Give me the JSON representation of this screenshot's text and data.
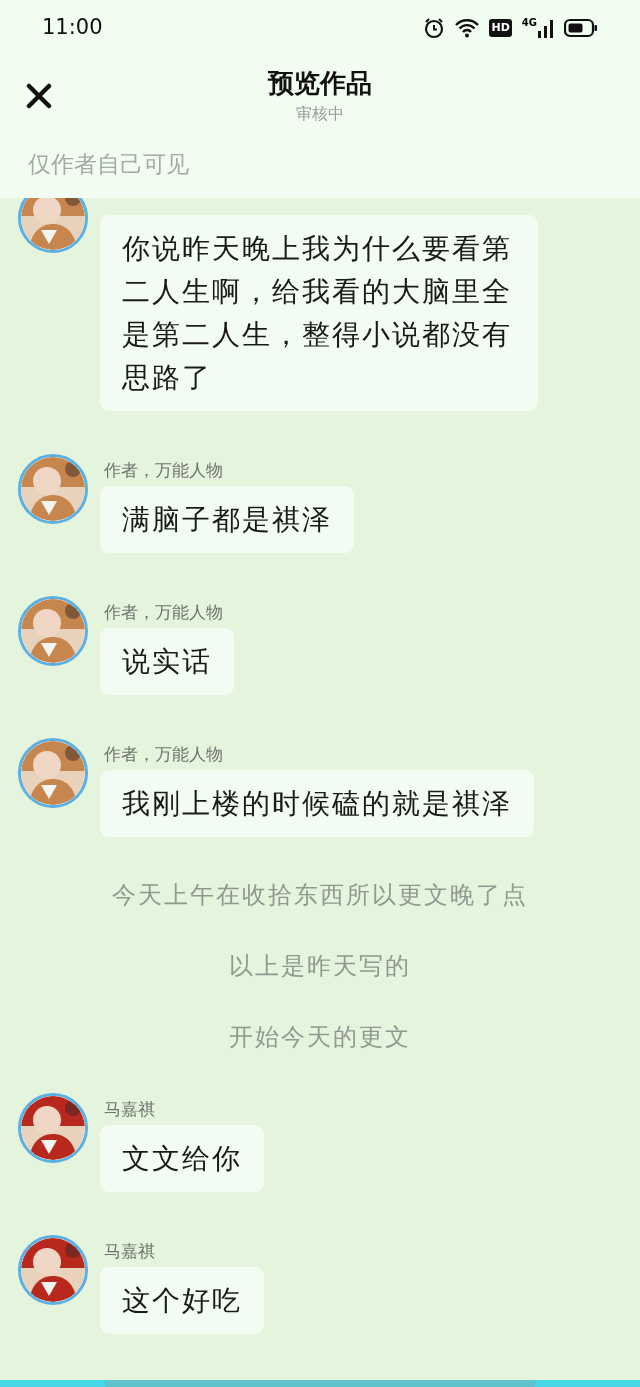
{
  "status_bar": {
    "time": "11:00",
    "hd": "HD",
    "network": "4G"
  },
  "header": {
    "title": "预览作品",
    "subtitle": "审核中"
  },
  "notice": "仅作者自己可见",
  "items": [
    {
      "kind": "message",
      "text": "你说昨天晚上我为什么要看第二人生啊，给我看的大脑里全是第二人生，整得小说都没有思路了"
    },
    {
      "kind": "message",
      "sender": "作者，万能人物",
      "text": "满脑子都是祺泽"
    },
    {
      "kind": "message",
      "sender": "作者，万能人物",
      "text": "说实话"
    },
    {
      "kind": "message",
      "sender": "作者，万能人物",
      "text": "我刚上楼的时候磕的就是祺泽"
    },
    {
      "kind": "note",
      "text": "今天上午在收拾东西所以更文晚了点"
    },
    {
      "kind": "note",
      "text": "以上是昨天写的"
    },
    {
      "kind": "note",
      "text": "开始今天的更文"
    },
    {
      "kind": "message",
      "sender": "马嘉祺",
      "text": "文文给你"
    },
    {
      "kind": "message",
      "sender": "马嘉祺",
      "text": "这个好吃"
    }
  ]
}
